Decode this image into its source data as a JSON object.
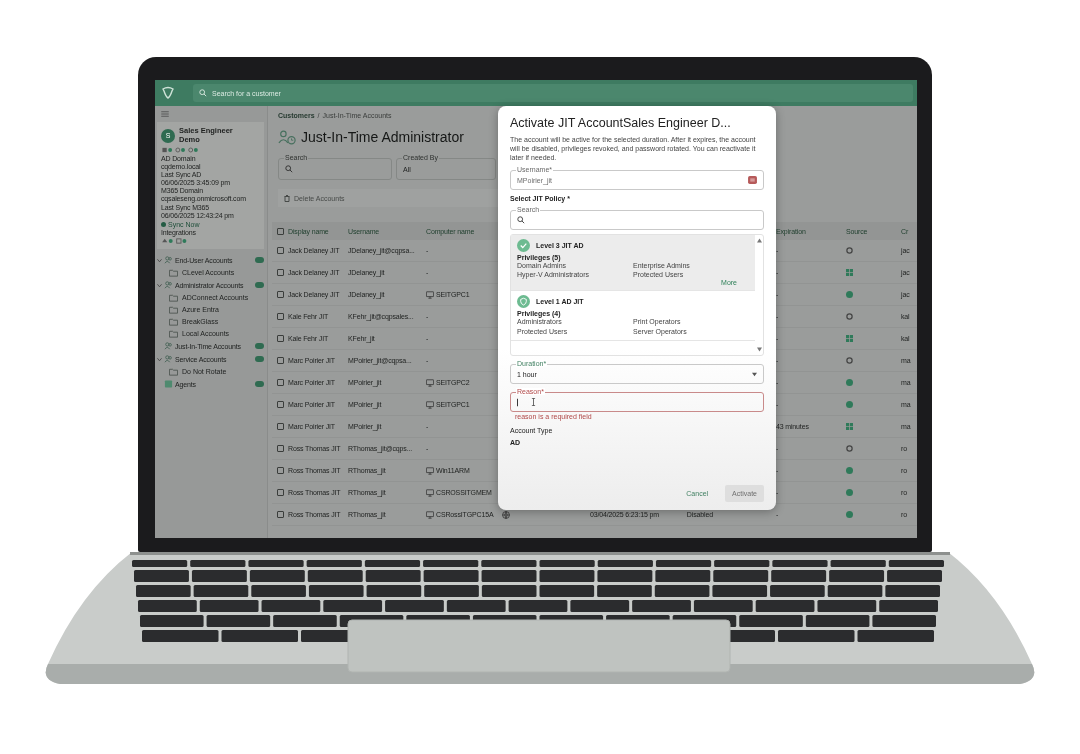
{
  "topbar": {
    "search_placeholder": "Search for a customer"
  },
  "sidebar": {
    "customer": {
      "avatar": "S",
      "name": "Sales Engineer Demo",
      "details": [
        "AD Domain",
        "cqdemo.local",
        "Last Sync AD",
        "06/06/2025 3:45:09 pm",
        "M365 Domain",
        "cqsaleseng.onmicrosoft.com",
        "Last Sync M365",
        "06/06/2025 12:43:24 pm"
      ],
      "sync_link": "Sync Now",
      "integrations_label": "Integrations"
    },
    "nav": [
      {
        "label": "End-User Accounts",
        "kind": "accounts",
        "expanded": true,
        "children": [
          {
            "label": "CLevel Accounts"
          }
        ]
      },
      {
        "label": "Administrator Accounts",
        "kind": "accounts",
        "expanded": true,
        "children": [
          {
            "label": "ADConnect Accounts"
          },
          {
            "label": "Azure Entra"
          },
          {
            "label": "BreakGlass"
          },
          {
            "label": "Local Accounts"
          }
        ]
      },
      {
        "label": "Just-In-Time Accounts",
        "kind": "accounts",
        "expanded": false
      },
      {
        "label": "Service Accounts",
        "kind": "accounts",
        "expanded": true,
        "children": [
          {
            "label": "Do Not Rotate"
          }
        ]
      },
      {
        "label": "Agents",
        "kind": "agents",
        "expanded": false
      }
    ]
  },
  "main": {
    "breadcrumb": {
      "parent": "Customers",
      "separator": "/",
      "current": "Just-In-Time Accounts"
    },
    "title": "Just-In-Time Administrator",
    "filters": [
      {
        "kind": "search",
        "label": "Search"
      },
      {
        "kind": "select",
        "label": "Created By",
        "value": "All"
      }
    ],
    "delete_button": {
      "label": "Delete Accounts",
      "disabled": true
    },
    "table": {
      "select_all_checked": false,
      "columns": [
        "Display name",
        "Username",
        "Computer name",
        "Expiration",
        "Source",
        "Cr"
      ],
      "rows": [
        {
          "checked": false,
          "display_name": "Jack Delaney JIT",
          "username": "JDelaney_jit@cqpsa...",
          "computer": {
            "kind": "none",
            "name": "-"
          },
          "expiration": "-",
          "source": {
            "kind": "ad"
          },
          "column_cut": "jac"
        },
        {
          "checked": false,
          "display_name": "Jack Delaney JIT",
          "username": "JDelaney_jit",
          "computer": {
            "kind": "none",
            "name": "-"
          },
          "expiration": "-",
          "source": {
            "kind": "entra"
          },
          "column_cut": "jac"
        },
        {
          "checked": false,
          "display_name": "Jack Delaney JIT",
          "username": "JDelaney_jit",
          "computer": {
            "kind": "device",
            "name": "SEITGPC1"
          },
          "expiration": "-",
          "source": {
            "kind": "agent"
          },
          "column_cut": "jac"
        },
        {
          "checked": false,
          "display_name": "Kale Fehr JIT",
          "username": "KFehr_jit@cqpsales...",
          "computer": {
            "kind": "none",
            "name": "-"
          },
          "expiration": "-",
          "source": {
            "kind": "ad"
          },
          "column_cut": "kal"
        },
        {
          "checked": false,
          "display_name": "Kale Fehr JIT",
          "username": "KFehr_jit",
          "computer": {
            "kind": "none",
            "name": "-"
          },
          "expiration": "-",
          "source": {
            "kind": "entra"
          },
          "column_cut": "kal"
        },
        {
          "checked": false,
          "display_name": "Marc Poirier JIT",
          "username": "MPoirier_jit@cqpsa...",
          "computer": {
            "kind": "none",
            "name": "-"
          },
          "expiration": "-",
          "source": {
            "kind": "ad"
          },
          "column_cut": "ma"
        },
        {
          "checked": false,
          "display_name": "Marc Poirier JIT",
          "username": "MPoirier_jit",
          "computer": {
            "kind": "device",
            "name": "SEITGPC2"
          },
          "expiration": "-",
          "source": {
            "kind": "agent"
          },
          "column_cut": "ma"
        },
        {
          "checked": false,
          "display_name": "Marc Poirier JIT",
          "username": "MPoirier_jit",
          "computer": {
            "kind": "device",
            "name": "SEITGPC1"
          },
          "expiration": "-",
          "source": {
            "kind": "agent"
          },
          "column_cut": "ma"
        },
        {
          "checked": false,
          "display_name": "Marc Poirier JIT",
          "username": "MPoirier_jit",
          "computer": {
            "kind": "none",
            "name": "-"
          },
          "expiration": "43 minutes",
          "source": {
            "kind": "entra"
          },
          "column_cut": "ma"
        },
        {
          "checked": false,
          "display_name": "Ross Thomas JIT",
          "username": "RThomas_jit@cqps...",
          "computer": {
            "kind": "none",
            "name": "-"
          },
          "expiration": "-",
          "source": {
            "kind": "ad"
          },
          "column_cut": "ro"
        },
        {
          "checked": false,
          "display_name": "Ross Thomas JIT",
          "username": "RThomas_jit",
          "computer": {
            "kind": "device",
            "name": "Win11ARM"
          },
          "expiration": "-",
          "source": {
            "kind": "agent"
          },
          "column_cut": "ro"
        },
        {
          "checked": false,
          "display_name": "Ross Thomas JIT",
          "username": "RThomas_jit",
          "computer": {
            "kind": "device",
            "name": "CSROSSITGMEM"
          },
          "expiration": "-",
          "source": {
            "kind": "agent"
          },
          "column_cut": "ro"
        },
        {
          "checked": false,
          "display_name": "Ross Thomas JIT",
          "username": "RThomas_jit",
          "computer": {
            "kind": "device",
            "name": "CSRossITGPC15A"
          },
          "column_4": {
            "kind": "globe"
          },
          "column_5": "03/04/2025 6:23:15 pm",
          "column_6": "Disabled",
          "expiration": "-",
          "source": {
            "kind": "agent"
          },
          "column_cut": "ro"
        }
      ]
    }
  },
  "modal": {
    "title": "Activate JIT AccountSales Engineer D...",
    "description": "The account will be active for the selected duration. After it expires, the account will be disabled, privileges revoked, and password rotated. You can reactivate it later if needed.",
    "username_field": {
      "label": "Username*",
      "value": "MPoirier_jit",
      "disabled": true
    },
    "policy_label": "Select JIT Policy *",
    "policy_search": {
      "label": "Search"
    },
    "policies": [
      {
        "name": "Level 3 JIT AD",
        "selected": true,
        "privileges_label": "Privileges (5)",
        "privileges": [
          "Domain Admins",
          "Enterprise Admins",
          "Hyper-V Administrators",
          "Protected Users"
        ],
        "more_link": "More"
      },
      {
        "name": "Level 1 AD JIT",
        "selected": false,
        "privileges_label": "Privileges (4)",
        "privileges": [
          "Administrators",
          "Print Operators",
          "Protected Users",
          "Server Operators"
        ]
      }
    ],
    "duration": {
      "label": "Duration*",
      "value": "1 hour"
    },
    "reason": {
      "label": "Reason*",
      "error": "reason is a required field"
    },
    "account_type": {
      "label": "Account Type",
      "value": "AD"
    },
    "buttons": [
      {
        "label": "Cancel",
        "kind": "text",
        "disabled": false
      },
      {
        "label": "Activate",
        "kind": "primary",
        "disabled": true
      }
    ]
  }
}
